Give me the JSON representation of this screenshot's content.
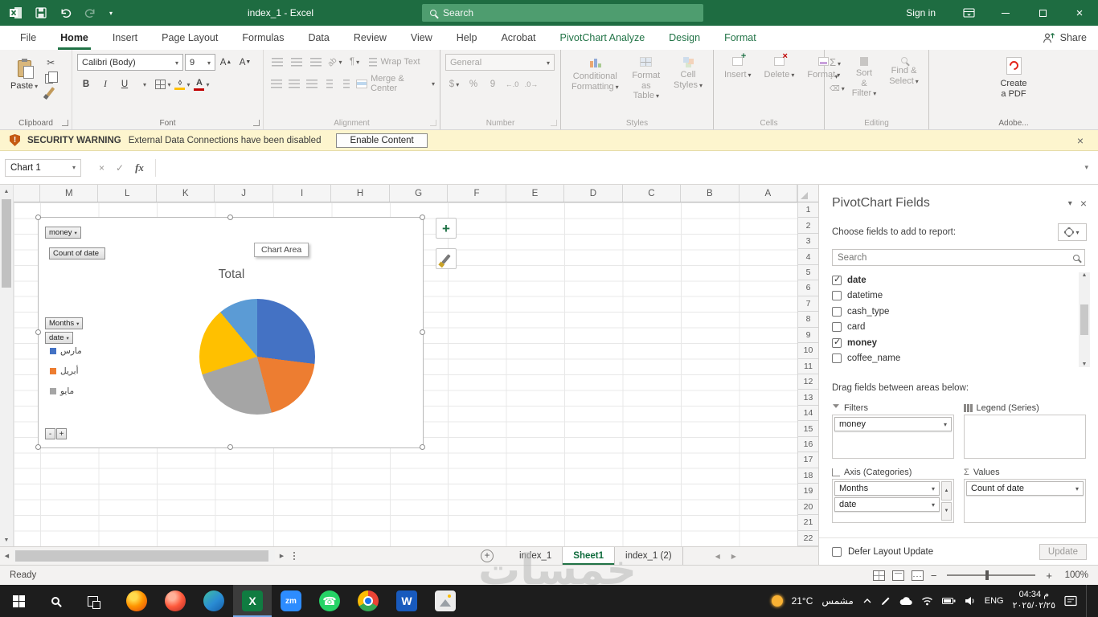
{
  "colors": {
    "excel_green": "#217346",
    "titlebar_green": "#1E6C41",
    "warning_bg": "#FDF5CE"
  },
  "titlebar": {
    "title": "index_1 - Excel",
    "search_placeholder": "Search",
    "sign_in_label": "Sign in"
  },
  "ribbon_tabs": {
    "tabs": [
      {
        "label": "File",
        "type": "file"
      },
      {
        "label": "Home",
        "type": "normal",
        "active": true
      },
      {
        "label": "Insert",
        "type": "normal"
      },
      {
        "label": "Page Layout",
        "type": "normal"
      },
      {
        "label": "Formulas",
        "type": "normal"
      },
      {
        "label": "Data",
        "type": "normal"
      },
      {
        "label": "Review",
        "type": "normal"
      },
      {
        "label": "View",
        "type": "normal"
      },
      {
        "label": "Help",
        "type": "normal"
      },
      {
        "label": "Acrobat",
        "type": "normal"
      },
      {
        "label": "PivotChart Analyze",
        "type": "contextual"
      },
      {
        "label": "Design",
        "type": "contextual"
      },
      {
        "label": "Format",
        "type": "contextual"
      }
    ],
    "share_label": "Share"
  },
  "ribbon": {
    "paste_label": "Paste",
    "font_name": "Calibri (Body)",
    "font_size": "9",
    "bold_label": "B",
    "italic_label": "I",
    "underline_label": "U",
    "wrap_text_label": "Wrap Text",
    "merge_center_label": "Merge & Center",
    "number_format": "General",
    "conditional_formatting_label": "Conditional\nFormatting",
    "format_as_table_label": "Format as\nTable",
    "cell_styles_label": "Cell\nStyles",
    "insert_label": "Insert",
    "delete_label": "Delete",
    "format_label": "Format",
    "sort_filter_label": "Sort &\nFilter",
    "find_select_label": "Find &\nSelect",
    "create_pdf_label": "Create\na PDF",
    "group_labels": [
      "Clipboard",
      "Font",
      "Alignment",
      "Number",
      "Styles",
      "Cells",
      "Editing",
      "Adobe..."
    ]
  },
  "security_bar": {
    "title": "SECURITY WARNING",
    "message": "External Data Connections have been disabled",
    "button_label": "Enable Content"
  },
  "formula_bar": {
    "name_box": "Chart 1",
    "fx_label": "fx",
    "formula_value": ""
  },
  "grid": {
    "columns": [
      "M",
      "L",
      "K",
      "J",
      "I",
      "H",
      "G",
      "F",
      "E",
      "D",
      "C",
      "B",
      "A"
    ],
    "row_count": 22
  },
  "chart": {
    "filter_button": "money",
    "value_button": "Count of date",
    "axis_button_1": "Months",
    "axis_button_2": "date",
    "tooltip": "Chart Area",
    "collapse_label": "-",
    "expand_label": "+"
  },
  "chart_data": {
    "type": "pie",
    "title": "Total",
    "legend_position": "left",
    "legend_visible": [
      {
        "label": "مارس",
        "color": "#4472C4"
      },
      {
        "label": "أبريل",
        "color": "#ED7D31"
      },
      {
        "label": "مايو",
        "color": "#A5A5A5"
      }
    ],
    "slices": [
      {
        "label": "مارس",
        "fraction": 0.27,
        "color": "#4472C4"
      },
      {
        "label": "أبريل",
        "fraction": 0.19,
        "color": "#ED7D31"
      },
      {
        "label": "مايو",
        "fraction": 0.24,
        "color": "#A5A5A5"
      },
      {
        "label": "",
        "fraction": 0.19,
        "color": "#FFC000"
      },
      {
        "label": "",
        "fraction": 0.11,
        "color": "#5B9BD5"
      }
    ]
  },
  "fields_pane": {
    "title": "PivotChart Fields",
    "choose_label": "Choose fields to add to report:",
    "search_placeholder": "Search",
    "fields": [
      {
        "name": "date",
        "checked": true
      },
      {
        "name": "datetime",
        "checked": false
      },
      {
        "name": "cash_type",
        "checked": false
      },
      {
        "name": "card",
        "checked": false
      },
      {
        "name": "money",
        "checked": true
      },
      {
        "name": "coffee_name",
        "checked": false
      }
    ],
    "drag_label": "Drag fields between areas below:",
    "areas": {
      "filters": {
        "label": "Filters",
        "items": [
          "money"
        ]
      },
      "legend": {
        "label": "Legend (Series)",
        "items": []
      },
      "axis": {
        "label": "Axis (Categories)",
        "items": [
          "Months",
          "date"
        ]
      },
      "values": {
        "label": "Values",
        "items": [
          "Count of date"
        ]
      }
    },
    "defer_label": "Defer Layout Update",
    "update_label": "Update"
  },
  "sheet_tabs": {
    "add_label": "+",
    "tabs": [
      {
        "label": "index_1",
        "active": false
      },
      {
        "label": "Sheet1",
        "active": true
      },
      {
        "label": "index_1 (2)",
        "active": false
      }
    ]
  },
  "status_bar": {
    "ready_label": "Ready",
    "zoom_out_label": "−",
    "zoom_in_label": "+",
    "zoom_label": "100%"
  },
  "watermark": {
    "text": "خمسات"
  },
  "taskbar": {
    "apps": [
      {
        "name": "firefox"
      },
      {
        "name": "firefox-red"
      },
      {
        "name": "edge"
      },
      {
        "name": "excel",
        "label": "X",
        "active": true
      },
      {
        "name": "zoom",
        "label": "zm"
      },
      {
        "name": "whatsapp",
        "label": "☎"
      },
      {
        "name": "chrome"
      },
      {
        "name": "word",
        "label": "W"
      },
      {
        "name": "photos"
      }
    ],
    "weather": {
      "temp": "21°C",
      "condition": "مشمس"
    },
    "language": "ENG",
    "time": "04:34 م",
    "date": "٢٠٢٥/٠٢/٢٥"
  }
}
